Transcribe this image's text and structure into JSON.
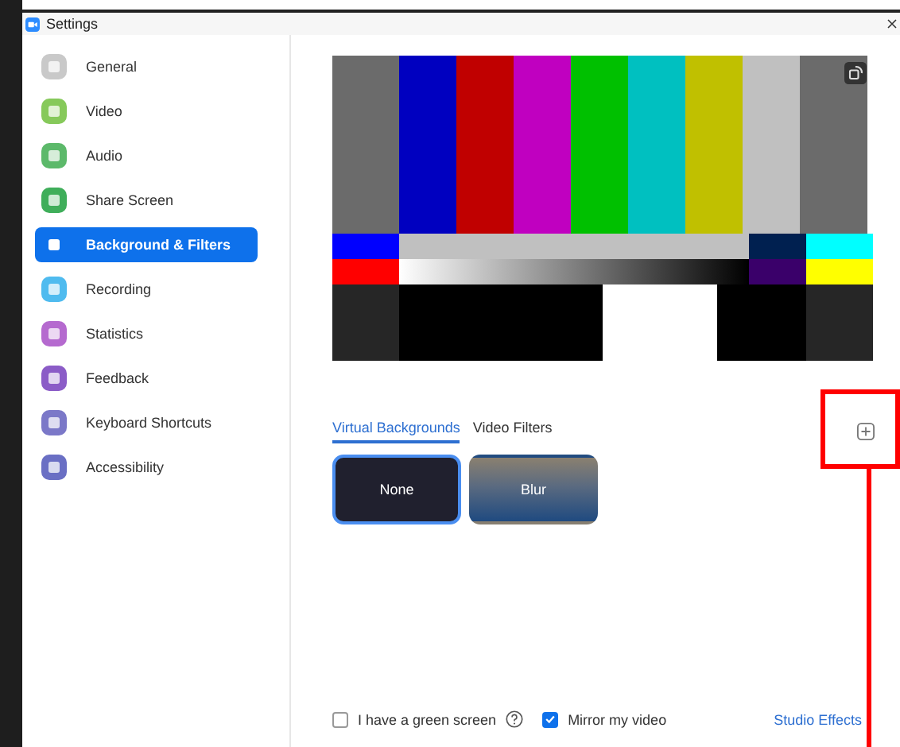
{
  "window": {
    "title": "Settings"
  },
  "sidebar": {
    "items": [
      {
        "label": "General",
        "selected": false,
        "color": "#c9c9c9"
      },
      {
        "label": "Video",
        "selected": false,
        "color": "#86c95a"
      },
      {
        "label": "Audio",
        "selected": false,
        "color": "#5cb96a"
      },
      {
        "label": "Share Screen",
        "selected": false,
        "color": "#3fae5a"
      },
      {
        "label": "Background & Filters",
        "selected": true
      },
      {
        "label": "Recording",
        "selected": false,
        "color": "#4fbbef"
      },
      {
        "label": "Statistics",
        "selected": false,
        "color": "#b56acf"
      },
      {
        "label": "Feedback",
        "selected": false,
        "color": "#8b5cc7"
      },
      {
        "label": "Keyboard Shortcuts",
        "selected": false,
        "color": "#7b78c8"
      },
      {
        "label": "Accessibility",
        "selected": false,
        "color": "#6a6fc4"
      }
    ]
  },
  "tabs": [
    {
      "label": "Virtual Backgrounds",
      "selected": true
    },
    {
      "label": "Video Filters",
      "selected": false
    }
  ],
  "backgrounds": [
    {
      "label": "None",
      "kind": "none",
      "selected": true
    },
    {
      "label": "Blur",
      "kind": "blur",
      "selected": false
    }
  ],
  "options": [
    {
      "label": "I have a green screen",
      "checked": false,
      "help": true
    },
    {
      "label": "Mirror my video",
      "checked": true,
      "help": false
    }
  ],
  "studio_effects": {
    "label": "Studio Effects"
  },
  "annotation": {
    "highlighted": true
  }
}
